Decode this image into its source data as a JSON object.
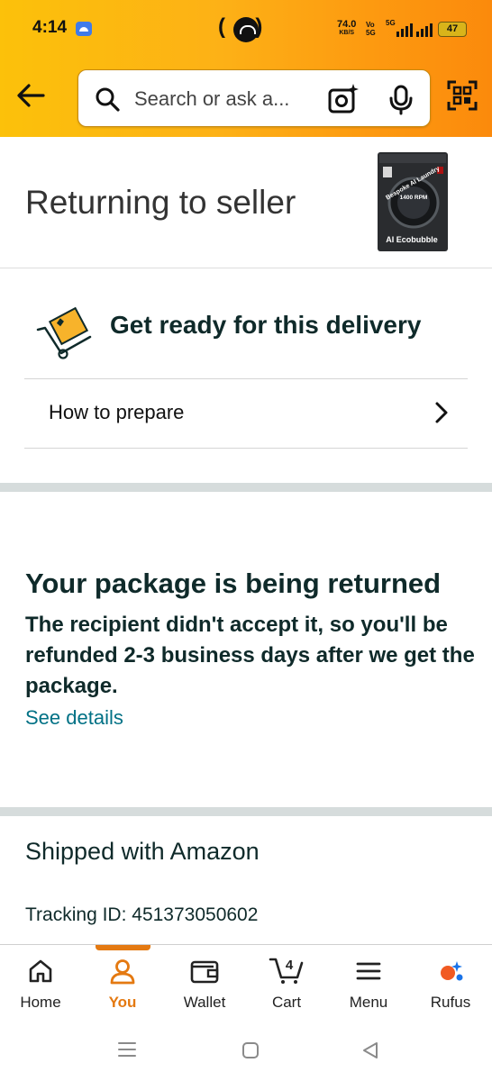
{
  "status_bar": {
    "time": "4:14",
    "net_speed": "74.0",
    "net_unit": "KB/S",
    "volte_top": "Vo",
    "volte_bottom": "5G",
    "network_top": "5G",
    "battery": "47"
  },
  "header": {
    "search_placeholder": "Search or ask a...",
    "back_icon": "back-arrow-icon",
    "search_icon": "search-icon",
    "camera_icon": "camera-sparkle-icon",
    "mic_icon": "microphone-icon",
    "qr_icon": "qr-scan-icon"
  },
  "page": {
    "title": "Returning to seller",
    "product_image_lines": [
      "Bespoke AI Laundry",
      "1400 RPM",
      "AI Ecobubble"
    ]
  },
  "prep": {
    "heading": "Get ready for this delivery",
    "how_to_prepare": "How to prepare"
  },
  "notice": {
    "title": "Your package is being returned",
    "body": "The recipient didn't accept it, so you'll be refunded 2-3 business days after we get the package.",
    "link": "See details"
  },
  "shipping": {
    "title": "Shipped with Amazon",
    "tracking_label": "Tracking ID:",
    "tracking_id": "451373050602"
  },
  "bottom_nav": {
    "items": [
      {
        "label": "Home",
        "icon": "home-icon"
      },
      {
        "label": "You",
        "icon": "person-icon",
        "active": true
      },
      {
        "label": "Wallet",
        "icon": "wallet-icon"
      },
      {
        "label": "Cart",
        "icon": "cart-icon",
        "badge": "4"
      },
      {
        "label": "Menu",
        "icon": "menu-icon"
      },
      {
        "label": "Rufus",
        "icon": "rufus-icon"
      }
    ]
  },
  "colors": {
    "header_gradient_start": "#fcc10a",
    "header_gradient_end": "#fb8a0c",
    "link": "#007185",
    "active_nav": "#e47911",
    "heading_text": "#0f2a2a"
  }
}
